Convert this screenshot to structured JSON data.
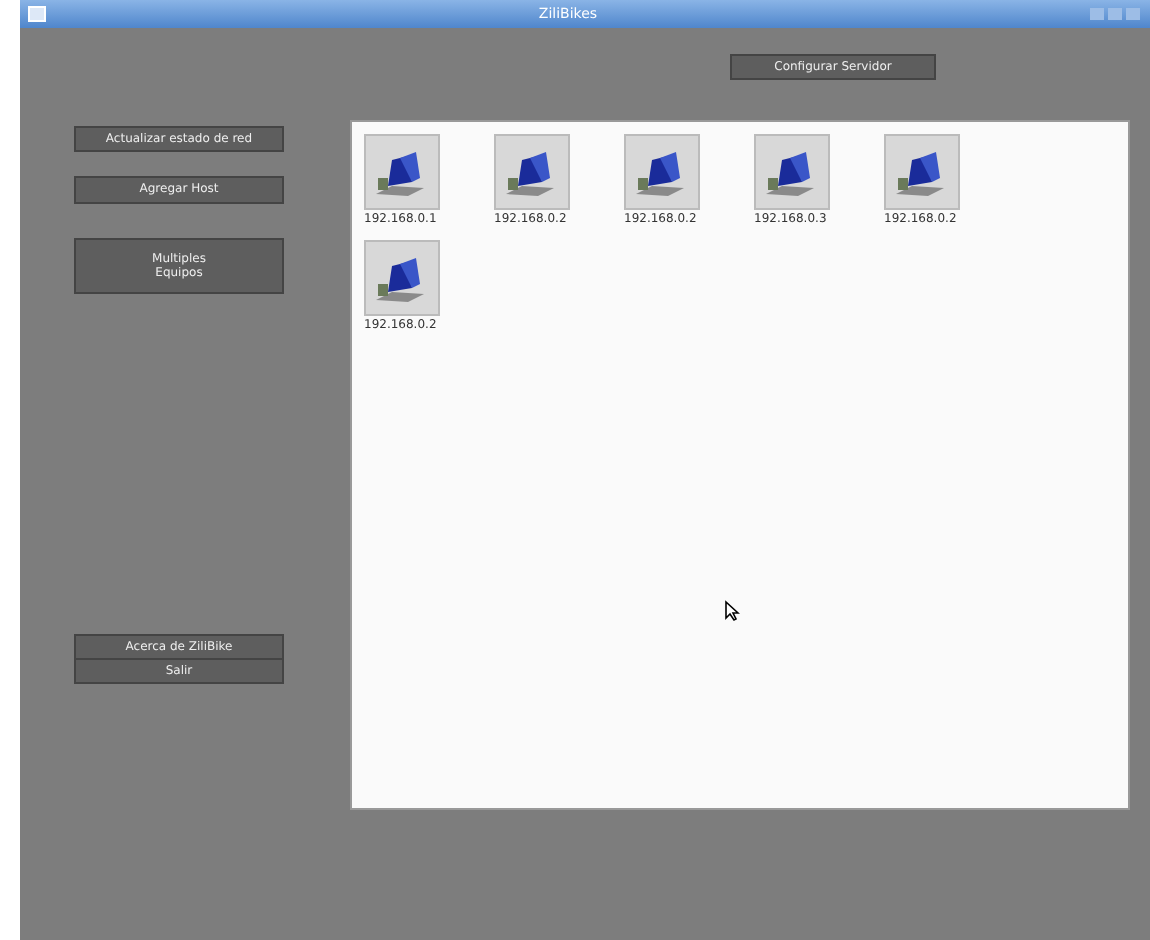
{
  "window": {
    "title": "ZiliBikes"
  },
  "top_button": "Configurar Servidor",
  "side_buttons_top": [
    "Actualizar estado de red",
    "Agregar Host",
    "Multiples\nEquipos"
  ],
  "side_buttons_bottom": [
    "Acerca de ZiliBike",
    "Salir"
  ],
  "hosts": [
    {
      "label": "192.168.0.1"
    },
    {
      "label": "192.168.0.2"
    },
    {
      "label": "192.168.0.2"
    },
    {
      "label": "192.168.0.3"
    },
    {
      "label": "192.168.0.2"
    },
    {
      "label": "192.168.0.2"
    }
  ]
}
